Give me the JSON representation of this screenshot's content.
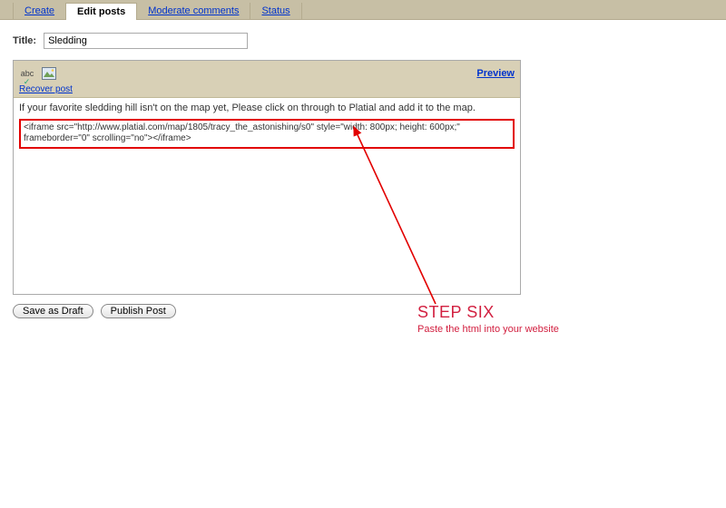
{
  "tabs": {
    "create": "Create",
    "edit": "Edit posts",
    "moderate": "Moderate comments",
    "status": "Status"
  },
  "title": {
    "label": "Title:",
    "value": "Sledding"
  },
  "toolbar": {
    "spellcheck_icon": "abc",
    "image_icon": "img",
    "preview": "Preview",
    "recover": "Recover post"
  },
  "editor": {
    "intro": "If your favorite sledding hill isn't on the map yet, Please click on through to Platial and add it to the map.",
    "code_line1": "<iframe src=\"http://www.platial.com/map/1805/tracy_the_astonishing/s0\" style=\"width: 800px; height: 600px;\"",
    "code_line2": "frameborder=\"0\" scrolling=\"no\"></iframe>"
  },
  "buttons": {
    "save_draft": "Save as Draft",
    "publish": "Publish Post"
  },
  "annotation": {
    "step": "STEP SIX",
    "sub": "Paste the html into your website"
  }
}
